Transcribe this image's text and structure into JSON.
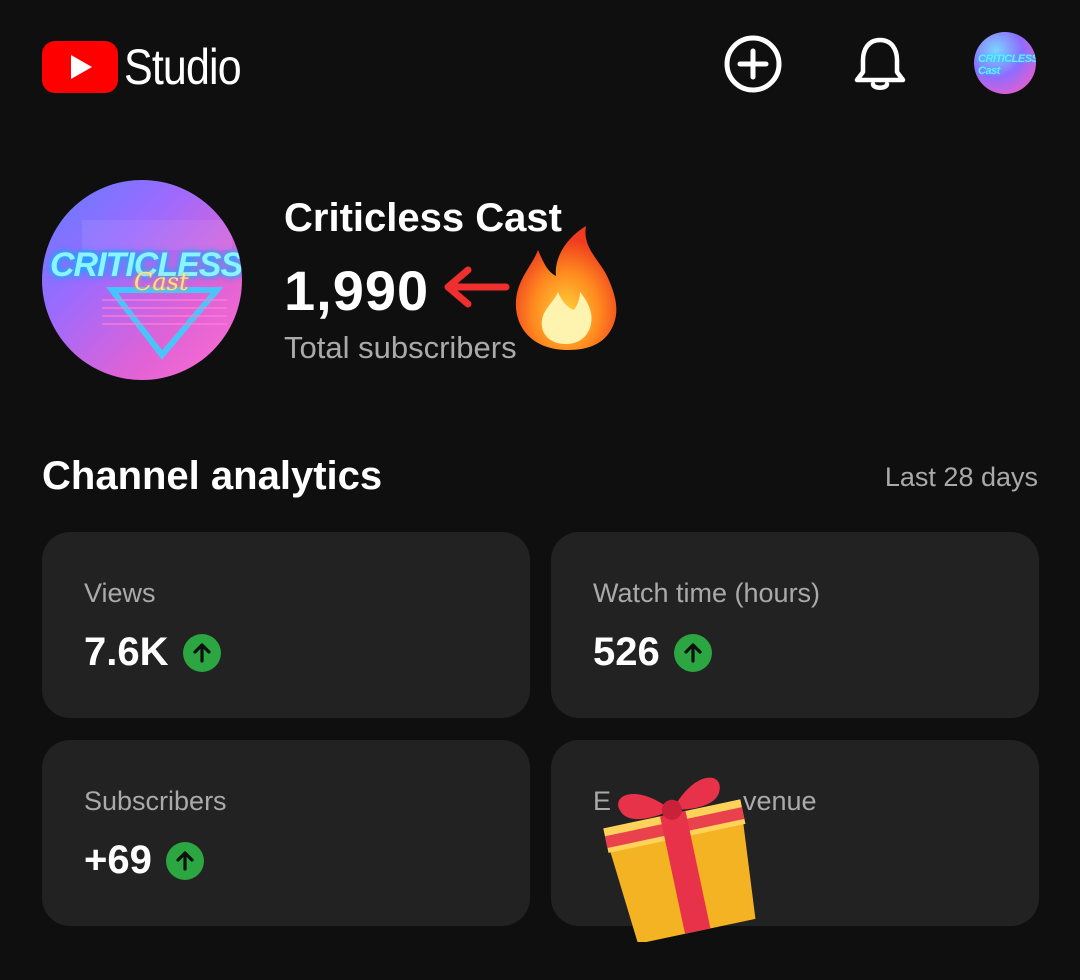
{
  "header": {
    "app_name": "Studio",
    "create_icon": "add-circle-icon",
    "notifications_icon": "bell-icon",
    "avatar_text": "CRITICLESS Cast"
  },
  "channel": {
    "name": "Criticless Cast",
    "subscriber_count": "1,990",
    "subscriber_label": "Total subscribers",
    "avatar_text_line1": "CRITICLESS",
    "avatar_text_line2": "Cast"
  },
  "analytics": {
    "title": "Channel analytics",
    "period": "Last 28 days",
    "cards": [
      {
        "label": "Views",
        "value": "7.6K",
        "trend": "up"
      },
      {
        "label": "Watch time (hours)",
        "value": "526",
        "trend": "up"
      },
      {
        "label": "Subscribers",
        "value": "+69",
        "trend": "up"
      },
      {
        "label": "Estimated revenue",
        "visible_label_fragments": [
          "E",
          "venue"
        ],
        "value": ""
      }
    ]
  },
  "annotations": {
    "arrow": "red-left-arrow",
    "fire": "fire-emoji",
    "gift": "gift-emoji"
  },
  "colors": {
    "background": "#0f0f0f",
    "card": "#222222",
    "youtube_red": "#ff0000",
    "trend_green": "#2ba640",
    "muted_text": "#aaaaaa"
  }
}
